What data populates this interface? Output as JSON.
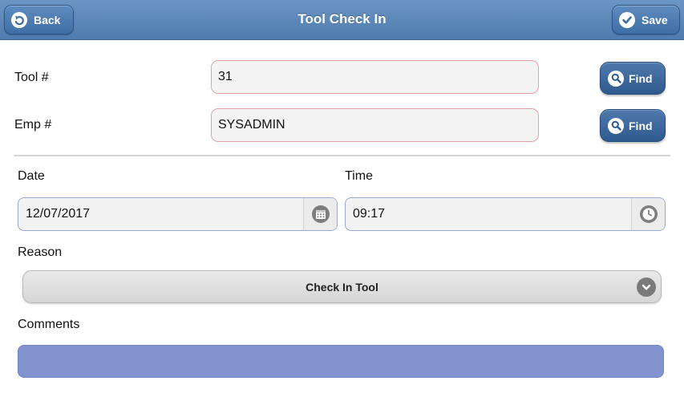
{
  "header": {
    "title": "Tool Check In",
    "back_label": "Back",
    "save_label": "Save"
  },
  "tool": {
    "label": "Tool #",
    "value": "31",
    "find_label": "Find"
  },
  "emp": {
    "label": "Emp #",
    "value": "SYSADMIN",
    "find_label": "Find"
  },
  "date": {
    "label": "Date",
    "value": "12/07/2017"
  },
  "time": {
    "label": "Time",
    "value": "09:17"
  },
  "reason": {
    "label": "Reason",
    "selected": "Check In Tool"
  },
  "comments": {
    "label": "Comments",
    "value": ""
  },
  "icons": {
    "back": "back-arrow-icon",
    "save": "checkmark-icon",
    "find": "search-icon",
    "date": "calendar-icon",
    "time": "clock-icon",
    "reason": "chevron-down-icon"
  },
  "colors": {
    "header": "#5a88bb",
    "button": "#3f6ea5",
    "field_border": "#e3a2a5",
    "comments_fill": "#8294cf"
  }
}
